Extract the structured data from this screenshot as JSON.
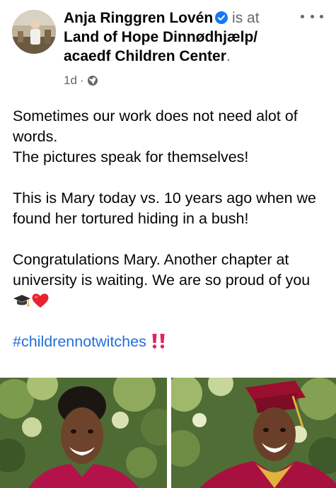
{
  "post": {
    "author": "Anja Ringgren Lovén",
    "verified_icon": "verified-badge-icon",
    "is_at": "is at",
    "location": "Land of Hope Dinnødhjælp/ acaedf Children Center",
    "location_period": ".",
    "time": "1d",
    "time_separator": "·",
    "audience_icon": "globe-icon",
    "more_icon": "more-horizontal-icon",
    "paragraphs": [
      "Sometimes our work does not need alot of words.",
      "The pictures speak for themselves!",
      "This is Mary today vs. 10 years ago when we found her tortured hiding in a bush!",
      "Congratulations Mary. Another chapter at university is waiting. We are so proud of you"
    ],
    "emojis_after_last_paragraph": [
      "graduation-cap-emoji",
      "red-heart-emoji"
    ],
    "hashtag": "#childrennotwitches",
    "hashtag_emoji": "double-exclamation-emoji",
    "photos": [
      "photo-left",
      "photo-right"
    ]
  },
  "colors": {
    "text": "#050505",
    "secondary": "#65676b",
    "link": "#216fdb",
    "verified": "#1877f2",
    "exclamation": "#e0245e",
    "heart": "#e8232f"
  }
}
